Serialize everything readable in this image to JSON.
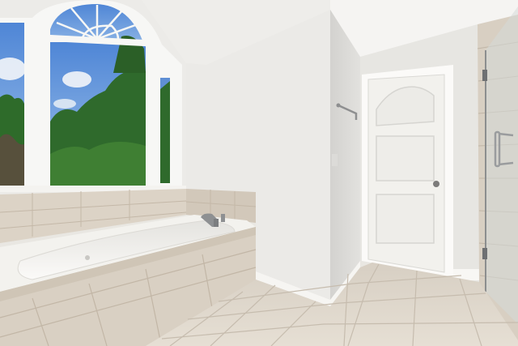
{
  "scene": {
    "kind": "photo",
    "subject": "bathroom",
    "colors": {
      "wall": "#e9e8e5",
      "ceiling": "#f2f1ef",
      "tile": "#d9d0c3",
      "tile_grout": "#bfb4a5",
      "tub": "#f6f5f2",
      "door": "#f1f0ec",
      "sky": "#6b9fe0",
      "foliage": "#2f6a2c",
      "glass": "#e3e6e4",
      "chrome": "#9a9c9e"
    },
    "objects": [
      "arched-window",
      "soaking-tub",
      "tiled-tub-deck",
      "towel-hook",
      "panel-door",
      "glass-shower",
      "floor-tile"
    ]
  }
}
